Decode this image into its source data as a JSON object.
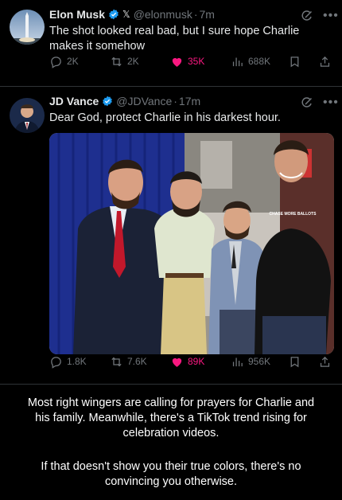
{
  "tweet1": {
    "name": "Elon Musk",
    "handle": "@elonmusk",
    "time": "7m",
    "badge_x": "𝕏",
    "text_line1": "The shot looked real bad, but I sure hope Charlie",
    "text_line2": "makes it somehow",
    "actions": {
      "replies": "2K",
      "reposts": "2K",
      "likes": "35K",
      "views": "688K"
    }
  },
  "tweet2": {
    "name": "JD Vance",
    "handle": "@JDVance",
    "time": "17m",
    "text": "Dear God, protect Charlie in his darkest hour.",
    "photo_shirt_text": "CHASE MORE BALLOTS",
    "actions": {
      "replies": "1.8K",
      "reposts": "7.6K",
      "likes": "89K",
      "views": "956K"
    }
  },
  "caption": {
    "para1_line1": "Most right wingers are calling for prayers for Charlie and",
    "para1_line2": "his family. Meanwhile, there's a TikTok trend rising for",
    "para1_line3": "celebration videos.",
    "para2_line1": "If that doesn't show you their true colors, there's no",
    "para2_line2": "convincing you otherwise."
  },
  "separator": "·",
  "colors": {
    "muted": "#71767b",
    "like": "#f91880",
    "verified": "#1d9bf0",
    "background": "#000000"
  },
  "icons": [
    "verified-badge-icon",
    "grok-icon",
    "more-icon",
    "reply-icon",
    "repost-icon",
    "like-icon",
    "views-icon",
    "bookmark-icon",
    "share-icon"
  ]
}
